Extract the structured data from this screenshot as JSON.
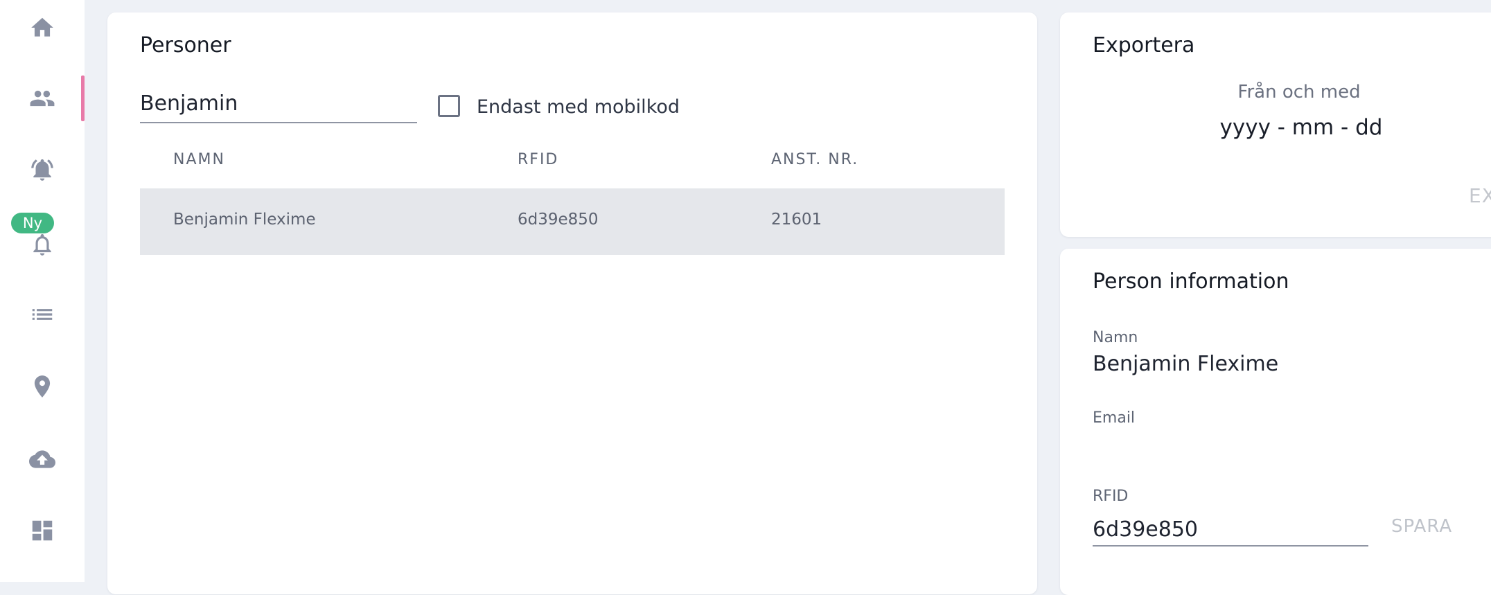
{
  "sidebar": {
    "items": [
      {
        "icon": "home-icon"
      },
      {
        "icon": "people-icon",
        "active": true
      },
      {
        "icon": "alarm-bell-icon"
      },
      {
        "icon": "bell-icon",
        "badge": "Ny"
      },
      {
        "icon": "list-icon"
      },
      {
        "icon": "location-pin-icon"
      },
      {
        "icon": "cloud-upload-icon"
      },
      {
        "icon": "dashboard-icon"
      }
    ],
    "badge_color": "#41b883",
    "active_indicator_color": "#e87aa8"
  },
  "personer": {
    "title": "Personer",
    "search_value": "Benjamin",
    "checkbox_label": "Endast med mobilkod",
    "checkbox_checked": false,
    "columns": [
      "NAMN",
      "RFID",
      "ANST. NR."
    ],
    "rows": [
      {
        "name": "Benjamin Flexime",
        "rfid": "6d39e850",
        "anst_nr": "21601"
      }
    ]
  },
  "exportera": {
    "title": "Exportera",
    "from_label": "Från och med",
    "from_value": "yyyy - mm - dd",
    "button_label": "EX"
  },
  "person_info": {
    "title": "Person information",
    "name_label": "Namn",
    "name_value": "Benjamin Flexime",
    "email_label": "Email",
    "email_value": "",
    "rfid_label": "RFID",
    "rfid_value": "6d39e850",
    "save_label": "SPARA"
  }
}
